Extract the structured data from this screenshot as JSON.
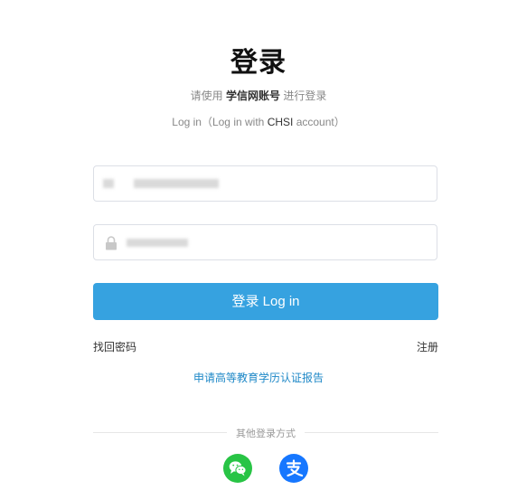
{
  "title": "登录",
  "subtitle_cn": {
    "prefix": "请使用",
    "highlight": "学信网账号",
    "suffix": "进行登录"
  },
  "subtitle_en": {
    "prefix": "Log in（Log in with",
    "highlight": "CHSI",
    "suffix": "account）"
  },
  "login_button": "登录 Log in",
  "forgot_password": "找回密码",
  "register": "注册",
  "apply_report": "申请高等教育学历认证报告",
  "other_methods": "其他登录方式",
  "icons": {
    "lock": "lock-icon",
    "wechat": "wechat-icon",
    "alipay": "alipay-icon"
  },
  "colors": {
    "primary": "#36a2e0",
    "link": "#1e88c7",
    "wechat": "#28c445",
    "alipay": "#1677ff"
  }
}
